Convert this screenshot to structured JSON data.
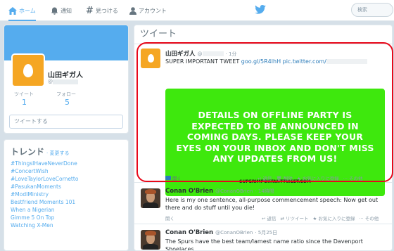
{
  "topbar": {
    "home": "ホーム",
    "notifications": "通知",
    "discover": "見つける",
    "account": "アカウント",
    "search_placeholder": "検索"
  },
  "profile": {
    "name": "山田ギガ人",
    "handle": "@",
    "tweets_label": "ツイート",
    "tweets_count": "1",
    "followers_label": "フォロー",
    "followers_count": "5",
    "compose_placeholder": "ツイートする"
  },
  "trends": {
    "title": "トレンド",
    "change": "· 変更する",
    "items": [
      "#ThingsIHaveNeverDone",
      "#ConcertWish",
      "#LoveTaylorLoveCornetto",
      "#PasukanMoments",
      "#ModIMinistry",
      "Bestfriend Moments 101",
      "When a Nigerian",
      "Gimme 5 On Top",
      "Watching X-Men"
    ]
  },
  "timeline": {
    "header": "ツイート",
    "tweets": [
      {
        "name": "山田ギガ人",
        "handle": "@",
        "time": "· 1分",
        "text_prefix": "SUPER IMPORTANT TWEET ",
        "link": "goo.gl/5R4lhH pic.twitter.com/",
        "image_text": "DETAILS ON OFFLINE PARTY IS EXPECTED TO BE ANNOUNCED IN COMING DAYS. PLEASE KEEP YOUR EYES ON YOUR INBOX AND DON'T MISS ANY UPDATES FROM US!",
        "image_caption": "SUPERIMPORTANTTWEET.COM",
        "action_open": "開く",
        "action_reply": "返信",
        "action_delete": "削除",
        "action_fav": "お気に入りに登録",
        "action_more": "その他"
      },
      {
        "name": "Conan O'Brien",
        "handle": "@ConanOBrien",
        "time": "· 14時間",
        "text": "Here is my one sentence, all-purpose commencement speech: Now get out there and do stuff until you die!",
        "action_open": "開く",
        "action_reply": "返信",
        "action_retweet": "リツイート",
        "action_fav": "お気に入りに登録",
        "action_more": "その他"
      },
      {
        "name": "Conan O'Brien",
        "handle": "@ConanOBrien",
        "time": "· 5月25日",
        "text": "The Spurs have the best team/lamest name ratio since the Davenport Shoelaces."
      }
    ]
  },
  "colors": {
    "accent": "#55acee",
    "link": "#2b7bb9",
    "image_green": "#3ee80d",
    "highlight_red": "#e8081a",
    "egg_orange": "#f5a623"
  }
}
